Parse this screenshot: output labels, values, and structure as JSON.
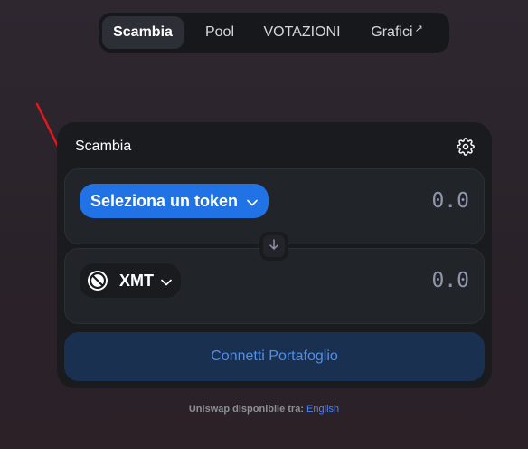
{
  "nav": {
    "items": [
      {
        "label": "Scambia",
        "active": true
      },
      {
        "label": "Pool",
        "active": false
      },
      {
        "label": "VOTAZIONI",
        "active": false
      },
      {
        "label": "Grafici",
        "active": false,
        "external": true
      }
    ],
    "external_arrow": "↗"
  },
  "swap": {
    "title": "Scambia",
    "settings_icon": "gear-icon",
    "input": {
      "select_label": "Seleziona un token",
      "amount": "0.0"
    },
    "output": {
      "token_symbol": "XMT",
      "amount": "0.0"
    },
    "switch_icon": "arrow-down-icon",
    "connect_label": "Connetti Portafoglio"
  },
  "footer": {
    "prefix": "Uniswap disponibile tra:",
    "language": "English"
  },
  "colors": {
    "accent": "#2172e5",
    "annotation": "#e0191c",
    "connect_text": "#5090ea"
  }
}
